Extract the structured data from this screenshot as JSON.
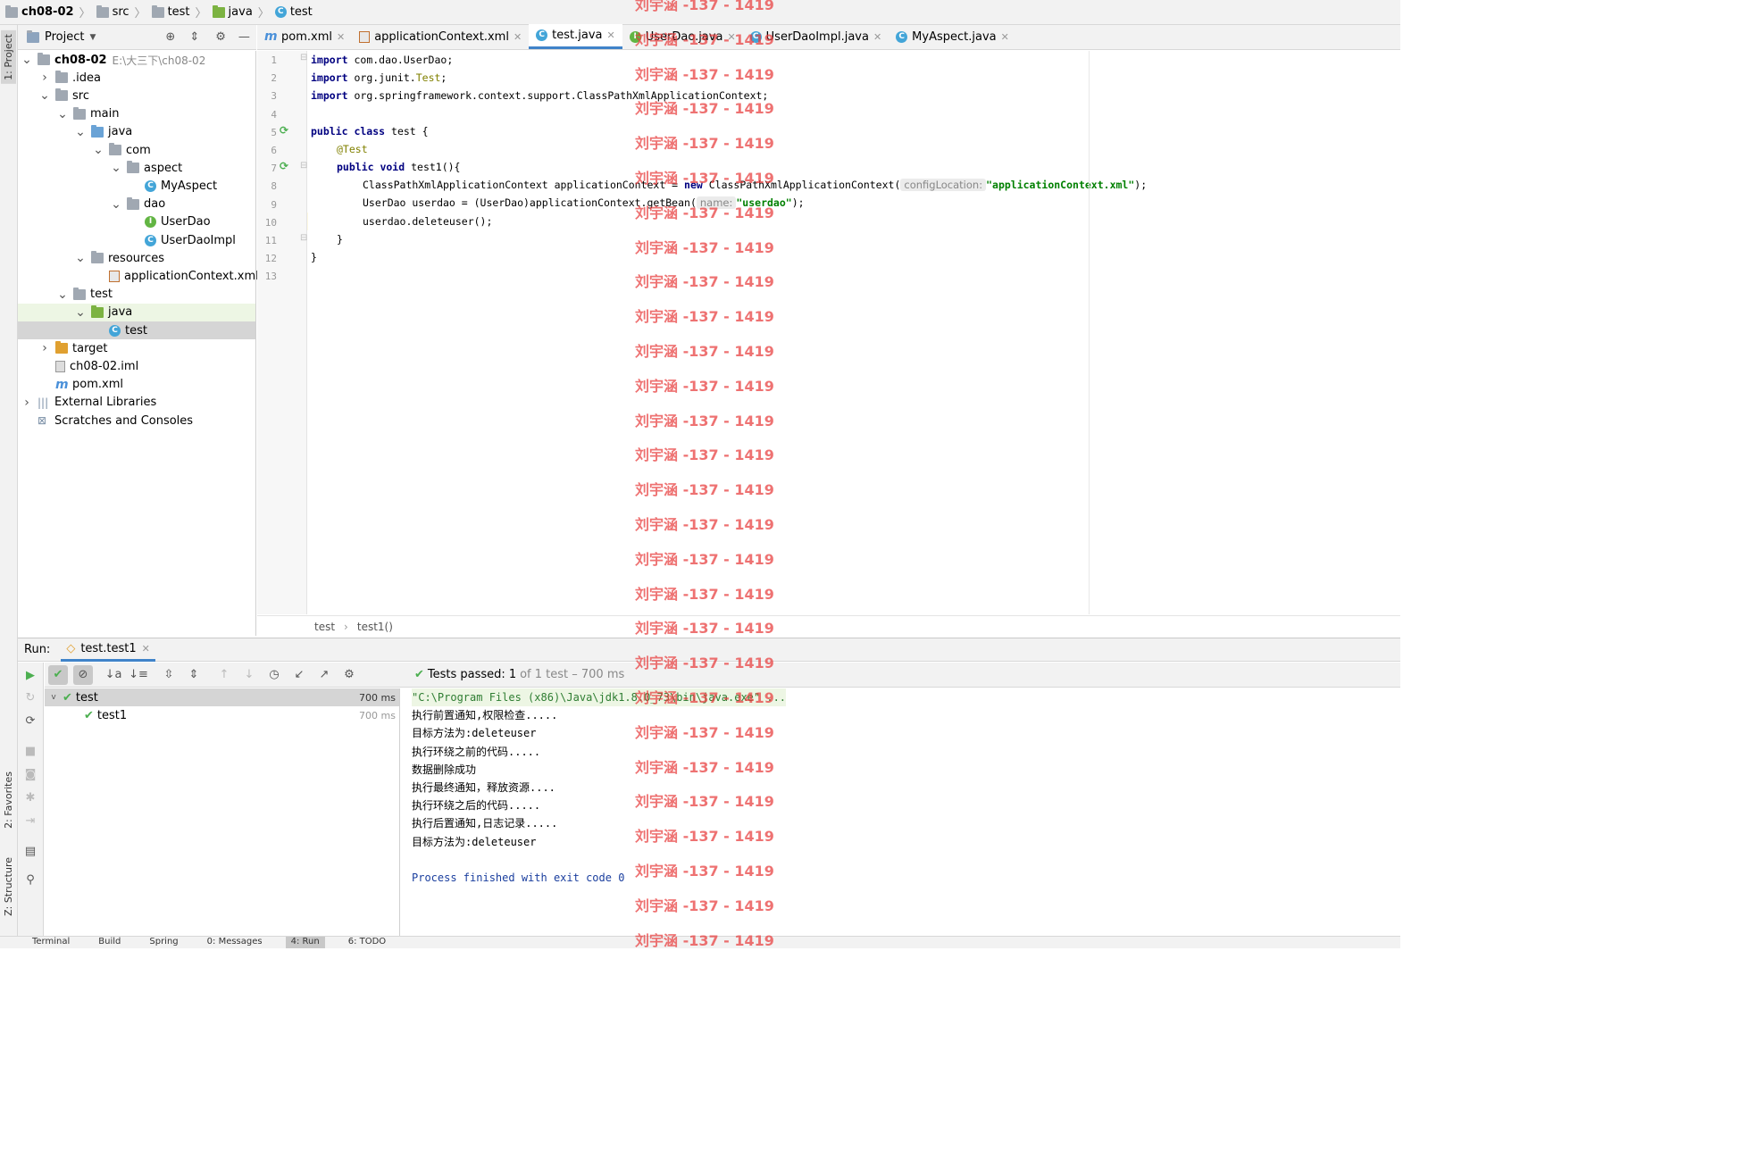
{
  "breadcrumb": [
    "ch08-02",
    "src",
    "test",
    "java",
    "test"
  ],
  "side_tabs": {
    "project": "1: Project",
    "favorites": "2: Favorites",
    "structure": "Z: Structure"
  },
  "project_panel": {
    "title": "Project",
    "tree": [
      {
        "label": "ch08-02",
        "hint": "E:\\大三下\\ch08-02",
        "level": 0,
        "arrow": "v",
        "icon": "folder",
        "bold": true
      },
      {
        "label": ".idea",
        "level": 1,
        "arrow": ">",
        "icon": "folder"
      },
      {
        "label": "src",
        "level": 1,
        "arrow": "v",
        "icon": "folder"
      },
      {
        "label": "main",
        "level": 2,
        "arrow": "v",
        "icon": "folder"
      },
      {
        "label": "java",
        "level": 3,
        "arrow": "v",
        "icon": "folder-blue"
      },
      {
        "label": "com",
        "level": 4,
        "arrow": "v",
        "icon": "folder"
      },
      {
        "label": "aspect",
        "level": 5,
        "arrow": "v",
        "icon": "folder"
      },
      {
        "label": "MyAspect",
        "level": 6,
        "arrow": "",
        "icon": "class"
      },
      {
        "label": "dao",
        "level": 5,
        "arrow": "v",
        "icon": "folder"
      },
      {
        "label": "UserDao",
        "level": 6,
        "arrow": "",
        "icon": "interface"
      },
      {
        "label": "UserDaoImpl",
        "level": 6,
        "arrow": "",
        "icon": "class"
      },
      {
        "label": "resources",
        "level": 3,
        "arrow": "v",
        "icon": "folder"
      },
      {
        "label": "applicationContext.xml",
        "level": 4,
        "arrow": "",
        "icon": "xml"
      },
      {
        "label": "test",
        "level": 2,
        "arrow": "v",
        "icon": "folder"
      },
      {
        "label": "java",
        "level": 3,
        "arrow": "v",
        "icon": "folder-green",
        "highlight": true
      },
      {
        "label": "test",
        "level": 4,
        "arrow": "",
        "icon": "class",
        "selected": true
      },
      {
        "label": "target",
        "level": 1,
        "arrow": ">",
        "icon": "folder-orange"
      },
      {
        "label": "ch08-02.iml",
        "level": 1,
        "arrow": "",
        "icon": "file"
      },
      {
        "label": "pom.xml",
        "level": 1,
        "arrow": "",
        "icon": "maven"
      },
      {
        "label": "External Libraries",
        "level": 0,
        "arrow": ">",
        "icon": "libs"
      },
      {
        "label": "Scratches and Consoles",
        "level": 0,
        "arrow": "",
        "icon": "scratch"
      }
    ]
  },
  "editor_tabs": [
    {
      "label": "pom.xml",
      "icon": "maven"
    },
    {
      "label": "applicationContext.xml",
      "icon": "xml"
    },
    {
      "label": "test.java",
      "icon": "class",
      "active": true
    },
    {
      "label": "UserDao.java",
      "icon": "interface"
    },
    {
      "label": "UserDaoImpl.java",
      "icon": "class"
    },
    {
      "label": "MyAspect.java",
      "icon": "class"
    }
  ],
  "editor_breadcrumb": [
    "test",
    "test1()"
  ],
  "code_lines": [
    "1",
    "2",
    "3",
    "4",
    "5",
    "6",
    "7",
    "8",
    "9",
    "10",
    "11",
    "12",
    "13"
  ],
  "code": {
    "l1a": "import",
    "l1b": " com.dao.UserDao;",
    "l2a": "import",
    "l2b": " org.junit.",
    "l2c": "Test",
    ";": ";",
    "l3a": "import",
    "l3b": " org.springframework.context.support.ClassPathXmlApplicationContext;",
    "l5a": "public class",
    "l5b": " test {",
    "l6": "@Test",
    "l7a": "public void",
    "l7b": " test1(){",
    "l8a": "ClassPathXmlApplicationContext applicationContext = ",
    "l8b": "new",
    "l8c": " ClassPathXmlApplicationContext(",
    "l8hint": "configLocation:",
    "l8str": "\"applicationContext.xml\"",
    "l8end": ");",
    "l9a": "UserDao userdao = (UserDao)applicationContext.getBean(",
    "l9hint": "name:",
    "l9str": "\"userdao\"",
    "l9end": ");",
    "l10": "userdao.deleteuser();",
    "l11": "}",
    "l12": "}"
  },
  "run": {
    "label": "Run:",
    "tab": "test.test1",
    "status_prefix": "Tests passed:",
    "status_count": "1",
    "status_suffix": "of 1 test – 700 ms",
    "tree": [
      {
        "label": "test",
        "time": "700 ms"
      },
      {
        "label": "test1",
        "time": "700 ms"
      }
    ]
  },
  "console": [
    "\"C:\\Program Files (x86)\\Java\\jdk1.8.0_73\\bin\\java.exe\" ...",
    "执行前置通知,权限检查.....",
    "目标方法为:deleteuser",
    "执行环绕之前的代码.....",
    "数据删除成功",
    "执行最终通知，释放资源....",
    "执行环绕之后的代码.....",
    "执行后置通知,日志记录.....",
    "目标方法为:deleteuser",
    "",
    "Process finished with exit code 0"
  ],
  "bottom_tabs": [
    "Terminal",
    "Build",
    "Spring",
    "0: Messages",
    "4: Run",
    "6: TODO"
  ],
  "watermark": "刘宇涵 -137 - 1419",
  "colors": {
    "accent": "#4083c9",
    "pass": "#4caf50",
    "keyword": "#000080",
    "string": "#008000",
    "annotation": "#808000",
    "watermark": "#e83c3c"
  }
}
